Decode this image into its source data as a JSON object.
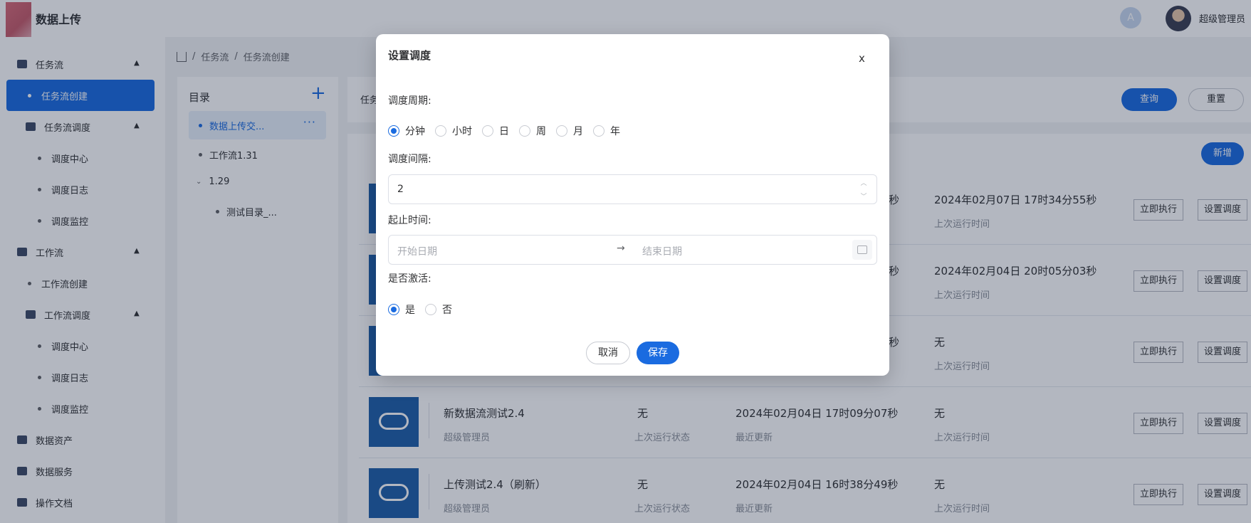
{
  "header": {
    "app_title": "数据上传",
    "user_name": "超级管理员",
    "avatar_icon": "avatar-icon"
  },
  "sidebar": {
    "items": [
      {
        "label": "任务流",
        "level": 0
      },
      {
        "label": "任务流创建",
        "level": 1,
        "active": true
      },
      {
        "label": "任务流调度",
        "level": 1
      },
      {
        "label": "调度中心",
        "level": 2
      },
      {
        "label": "调度日志",
        "level": 2
      },
      {
        "label": "调度监控",
        "level": 2
      },
      {
        "label": "工作流",
        "level": 0
      },
      {
        "label": "工作流创建",
        "level": 1
      },
      {
        "label": "工作流调度",
        "level": 1
      },
      {
        "label": "调度中心",
        "level": 2
      },
      {
        "label": "调度日志",
        "level": 2
      },
      {
        "label": "调度监控",
        "level": 2
      },
      {
        "label": "数据资产",
        "level": 0
      },
      {
        "label": "数据服务",
        "level": 0
      },
      {
        "label": "操作文档",
        "level": 0
      }
    ]
  },
  "breadcrumb": {
    "items": [
      "任务流",
      "任务流创建"
    ],
    "separator": "/"
  },
  "directory": {
    "title": "目录",
    "add_label": "+",
    "items": [
      {
        "label": "数据上传交...",
        "selected": true
      },
      {
        "label": "工作流1.31"
      },
      {
        "label": "1.29"
      },
      {
        "label": "测试目录_..."
      }
    ]
  },
  "search": {
    "label": "任务",
    "query_button": "查询",
    "reset_button": "重置"
  },
  "list": {
    "add_button": "新增",
    "rows": [
      {
        "name": "",
        "owner": "",
        "status": "",
        "status_label": "",
        "updated": "秒",
        "updated_label": "",
        "last_run": "2024年02月07日 17时34分55秒",
        "last_run_label": "上次运行时间"
      },
      {
        "name": "",
        "owner": "",
        "status": "",
        "status_label": "",
        "updated": "秒",
        "updated_label": "",
        "last_run": "2024年02月04日 20时05分03秒",
        "last_run_label": "上次运行时间"
      },
      {
        "name": "",
        "owner": "",
        "status": "",
        "status_label": "",
        "updated": "秒",
        "updated_label": "",
        "last_run": "无",
        "last_run_label": "上次运行时间"
      },
      {
        "name": "新数据流测试2.4",
        "owner": "超级管理员",
        "status": "无",
        "status_label": "上次运行状态",
        "updated": "2024年02月04日 17时09分07秒",
        "updated_label": "最近更新",
        "last_run": "无",
        "last_run_label": "上次运行时间"
      },
      {
        "name": "上传测试2.4（刷新）",
        "owner": "超级管理员",
        "status": "无",
        "status_label": "上次运行状态",
        "updated": "2024年02月04日 16时38分49秒",
        "updated_label": "最近更新",
        "last_run": "无",
        "last_run_label": "上次运行时间"
      }
    ],
    "run_button": "立即执行",
    "schedule_button": "设置调度"
  },
  "dialog": {
    "title": "设置调度",
    "close_label": "x",
    "period_label": "调度周期:",
    "period_options": [
      "分钟",
      "小时",
      "日",
      "周",
      "月",
      "年"
    ],
    "period_selected": "分钟",
    "interval_label": "调度间隔:",
    "interval_value": "2",
    "range_label": "起止时间:",
    "start_placeholder": "开始日期",
    "end_placeholder": "结束日期",
    "range_arrow": "→",
    "active_label": "是否激活:",
    "active_options": [
      "是",
      "否"
    ],
    "active_selected": "是",
    "cancel_button": "取消",
    "save_button": "保存"
  },
  "colors": {
    "primary": "#1a6be0",
    "overlay": "rgba(20,30,60,0.32)",
    "tile": "#1e5fa8"
  }
}
